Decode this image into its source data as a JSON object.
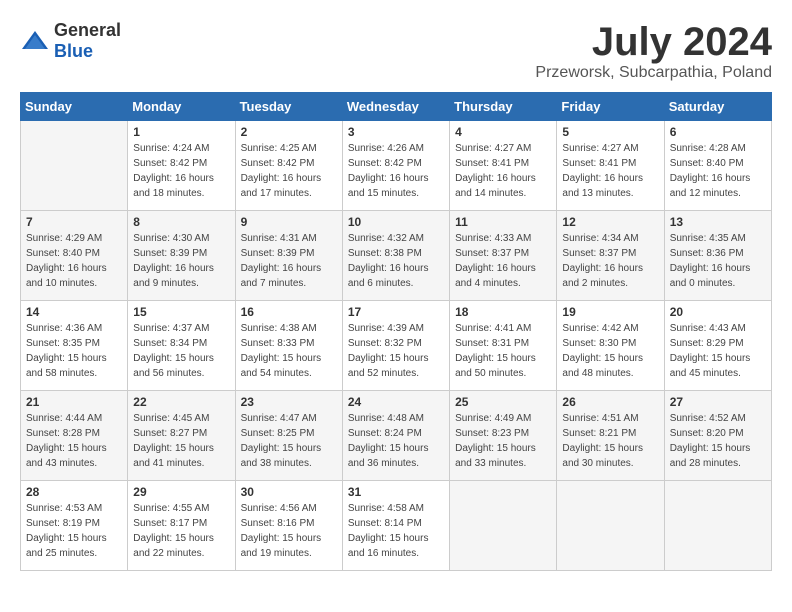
{
  "header": {
    "logo_general": "General",
    "logo_blue": "Blue",
    "month_year": "July 2024",
    "location": "Przeworsk, Subcarpathia, Poland"
  },
  "weekdays": [
    "Sunday",
    "Monday",
    "Tuesday",
    "Wednesday",
    "Thursday",
    "Friday",
    "Saturday"
  ],
  "weeks": [
    [
      {
        "day": "",
        "info": ""
      },
      {
        "day": "1",
        "info": "Sunrise: 4:24 AM\nSunset: 8:42 PM\nDaylight: 16 hours\nand 18 minutes."
      },
      {
        "day": "2",
        "info": "Sunrise: 4:25 AM\nSunset: 8:42 PM\nDaylight: 16 hours\nand 17 minutes."
      },
      {
        "day": "3",
        "info": "Sunrise: 4:26 AM\nSunset: 8:42 PM\nDaylight: 16 hours\nand 15 minutes."
      },
      {
        "day": "4",
        "info": "Sunrise: 4:27 AM\nSunset: 8:41 PM\nDaylight: 16 hours\nand 14 minutes."
      },
      {
        "day": "5",
        "info": "Sunrise: 4:27 AM\nSunset: 8:41 PM\nDaylight: 16 hours\nand 13 minutes."
      },
      {
        "day": "6",
        "info": "Sunrise: 4:28 AM\nSunset: 8:40 PM\nDaylight: 16 hours\nand 12 minutes."
      }
    ],
    [
      {
        "day": "7",
        "info": "Sunrise: 4:29 AM\nSunset: 8:40 PM\nDaylight: 16 hours\nand 10 minutes."
      },
      {
        "day": "8",
        "info": "Sunrise: 4:30 AM\nSunset: 8:39 PM\nDaylight: 16 hours\nand 9 minutes."
      },
      {
        "day": "9",
        "info": "Sunrise: 4:31 AM\nSunset: 8:39 PM\nDaylight: 16 hours\nand 7 minutes."
      },
      {
        "day": "10",
        "info": "Sunrise: 4:32 AM\nSunset: 8:38 PM\nDaylight: 16 hours\nand 6 minutes."
      },
      {
        "day": "11",
        "info": "Sunrise: 4:33 AM\nSunset: 8:37 PM\nDaylight: 16 hours\nand 4 minutes."
      },
      {
        "day": "12",
        "info": "Sunrise: 4:34 AM\nSunset: 8:37 PM\nDaylight: 16 hours\nand 2 minutes."
      },
      {
        "day": "13",
        "info": "Sunrise: 4:35 AM\nSunset: 8:36 PM\nDaylight: 16 hours\nand 0 minutes."
      }
    ],
    [
      {
        "day": "14",
        "info": "Sunrise: 4:36 AM\nSunset: 8:35 PM\nDaylight: 15 hours\nand 58 minutes."
      },
      {
        "day": "15",
        "info": "Sunrise: 4:37 AM\nSunset: 8:34 PM\nDaylight: 15 hours\nand 56 minutes."
      },
      {
        "day": "16",
        "info": "Sunrise: 4:38 AM\nSunset: 8:33 PM\nDaylight: 15 hours\nand 54 minutes."
      },
      {
        "day": "17",
        "info": "Sunrise: 4:39 AM\nSunset: 8:32 PM\nDaylight: 15 hours\nand 52 minutes."
      },
      {
        "day": "18",
        "info": "Sunrise: 4:41 AM\nSunset: 8:31 PM\nDaylight: 15 hours\nand 50 minutes."
      },
      {
        "day": "19",
        "info": "Sunrise: 4:42 AM\nSunset: 8:30 PM\nDaylight: 15 hours\nand 48 minutes."
      },
      {
        "day": "20",
        "info": "Sunrise: 4:43 AM\nSunset: 8:29 PM\nDaylight: 15 hours\nand 45 minutes."
      }
    ],
    [
      {
        "day": "21",
        "info": "Sunrise: 4:44 AM\nSunset: 8:28 PM\nDaylight: 15 hours\nand 43 minutes."
      },
      {
        "day": "22",
        "info": "Sunrise: 4:45 AM\nSunset: 8:27 PM\nDaylight: 15 hours\nand 41 minutes."
      },
      {
        "day": "23",
        "info": "Sunrise: 4:47 AM\nSunset: 8:25 PM\nDaylight: 15 hours\nand 38 minutes."
      },
      {
        "day": "24",
        "info": "Sunrise: 4:48 AM\nSunset: 8:24 PM\nDaylight: 15 hours\nand 36 minutes."
      },
      {
        "day": "25",
        "info": "Sunrise: 4:49 AM\nSunset: 8:23 PM\nDaylight: 15 hours\nand 33 minutes."
      },
      {
        "day": "26",
        "info": "Sunrise: 4:51 AM\nSunset: 8:21 PM\nDaylight: 15 hours\nand 30 minutes."
      },
      {
        "day": "27",
        "info": "Sunrise: 4:52 AM\nSunset: 8:20 PM\nDaylight: 15 hours\nand 28 minutes."
      }
    ],
    [
      {
        "day": "28",
        "info": "Sunrise: 4:53 AM\nSunset: 8:19 PM\nDaylight: 15 hours\nand 25 minutes."
      },
      {
        "day": "29",
        "info": "Sunrise: 4:55 AM\nSunset: 8:17 PM\nDaylight: 15 hours\nand 22 minutes."
      },
      {
        "day": "30",
        "info": "Sunrise: 4:56 AM\nSunset: 8:16 PM\nDaylight: 15 hours\nand 19 minutes."
      },
      {
        "day": "31",
        "info": "Sunrise: 4:58 AM\nSunset: 8:14 PM\nDaylight: 15 hours\nand 16 minutes."
      },
      {
        "day": "",
        "info": ""
      },
      {
        "day": "",
        "info": ""
      },
      {
        "day": "",
        "info": ""
      }
    ]
  ]
}
